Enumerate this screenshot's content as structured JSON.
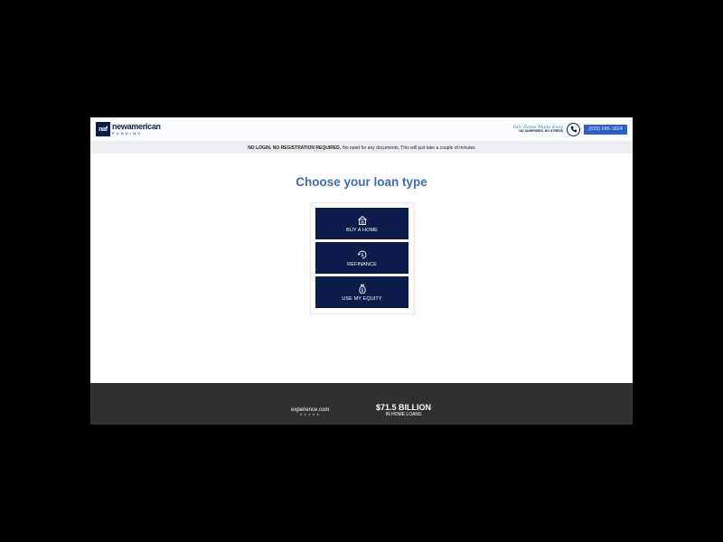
{
  "header": {
    "logo_mark": "naf",
    "logo_name": "newamerican",
    "logo_sub": "FUNDING",
    "tagline_script": "Fair Rates Made Easy",
    "tagline_caps": "NO SURPRISES, NO STRESS",
    "phone": "(833) 686-1824"
  },
  "banner": {
    "bold": "NO LOGIN, NO REGISTRATION REQUIRED.",
    "rest": "No need for any documents. This will just take a couple of minutes"
  },
  "main": {
    "title": "Choose your loan type",
    "options": [
      {
        "label": "BUY A HOME",
        "icon": "house-icon"
      },
      {
        "label": "REFINANCE",
        "icon": "refinance-icon"
      },
      {
        "label": "USE MY EQUITY",
        "icon": "money-bag-icon"
      }
    ]
  },
  "footer": {
    "review_site": "experience.com",
    "stars": "★★★★★",
    "stat_value": "$71.5 BILLION",
    "stat_label": "IN HOME LOANS"
  },
  "colors": {
    "navy": "#0b1b4a",
    "title_blue": "#3e6db1",
    "phone_button": "#2f5ec4",
    "footer_bg": "#303030"
  }
}
